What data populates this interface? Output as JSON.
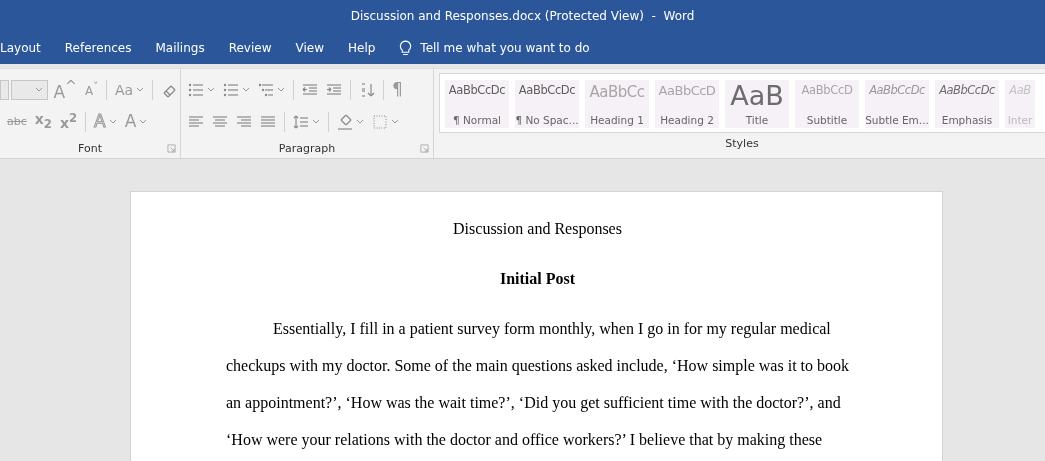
{
  "window": {
    "title": "Discussion and Responses.docx (Protected View)  -  Word"
  },
  "tabs": [
    {
      "label": "Layout"
    },
    {
      "label": "References"
    },
    {
      "label": "Mailings"
    },
    {
      "label": "Review"
    },
    {
      "label": "View"
    },
    {
      "label": "Help"
    }
  ],
  "tell_me": "Tell me what you want to do",
  "ribbon": {
    "disabled": true,
    "groups": [
      {
        "label": "Font",
        "rows": [
          [
            {
              "kind": "font-name"
            },
            {
              "kind": "font-size"
            },
            {
              "kind": "grow-font",
              "text": "A$^{^}$"
            },
            {
              "kind": "shrink-font",
              "text": "A$^{˅}$"
            },
            {
              "kind": "separator"
            },
            {
              "kind": "change-case",
              "text": "Aa",
              "dropdown": true
            },
            {
              "kind": "separator"
            },
            {
              "kind": "eraser"
            }
          ],
          [
            {
              "kind": "strikethrough",
              "text": "abc"
            },
            {
              "kind": "subscript",
              "text": "x$_{2}$"
            },
            {
              "kind": "superscript",
              "text": "x$^{2}$"
            },
            {
              "kind": "separator"
            },
            {
              "kind": "text-effects",
              "text": "A",
              "dropdown": true
            },
            {
              "kind": "font-color",
              "text": "A",
              "dropdown": true
            }
          ]
        ]
      },
      {
        "label": "Paragraph",
        "rows": [
          [
            {
              "kind": "bullets",
              "dropdown": true
            },
            {
              "kind": "numbering",
              "dropdown": true
            },
            {
              "kind": "multilevel",
              "dropdown": true
            },
            {
              "kind": "separator"
            },
            {
              "kind": "outdent"
            },
            {
              "kind": "indent"
            },
            {
              "kind": "separator"
            },
            {
              "kind": "sort"
            },
            {
              "kind": "separator"
            },
            {
              "kind": "show-marks",
              "text": "¶"
            }
          ],
          [
            {
              "kind": "align-left"
            },
            {
              "kind": "align-center"
            },
            {
              "kind": "align-right"
            },
            {
              "kind": "justify"
            },
            {
              "kind": "separator"
            },
            {
              "kind": "line-spacing",
              "dropdown": true
            },
            {
              "kind": "separator"
            },
            {
              "kind": "shading",
              "dropdown": true
            },
            {
              "kind": "borders",
              "dropdown": true
            }
          ]
        ]
      }
    ],
    "styles": {
      "label": "Styles",
      "items": [
        {
          "kind": "normal",
          "sample": "AaBbCcDc",
          "name": "¶ Normal"
        },
        {
          "kind": "normal",
          "sample": "AaBbCcDc",
          "name": "¶ No Spac..."
        },
        {
          "kind": "heading1",
          "sample": "AaBbCc",
          "name": "Heading 1"
        },
        {
          "kind": "heading2",
          "sample": "AaBbCcD",
          "name": "Heading 2"
        },
        {
          "kind": "title",
          "sample": "AaB",
          "name": "Title"
        },
        {
          "kind": "subtitle",
          "sample": "AaBbCcD",
          "name": "Subtitle"
        },
        {
          "kind": "subtle",
          "sample": "AaBbCcDc",
          "name": "Subtle Em..."
        },
        {
          "kind": "emphasis",
          "sample": "AaBbCcDc",
          "name": "Emphasis"
        },
        {
          "kind": "subtle",
          "sample": "AaB",
          "name": "Inter"
        }
      ]
    }
  },
  "document": {
    "title": "Discussion and Responses",
    "heading": "Initial Post",
    "paragraph": "Essentially, I fill in a patient survey form monthly, when I go in for my regular medical checkups with my doctor. Some of the main questions asked include, ‘How simple was it to book an appointment?’, ‘How was the wait time?’, ‘Did you get sufficient time with the doctor?’, and ‘How were your relations with the doctor and office workers?’ I believe that by making these"
  }
}
